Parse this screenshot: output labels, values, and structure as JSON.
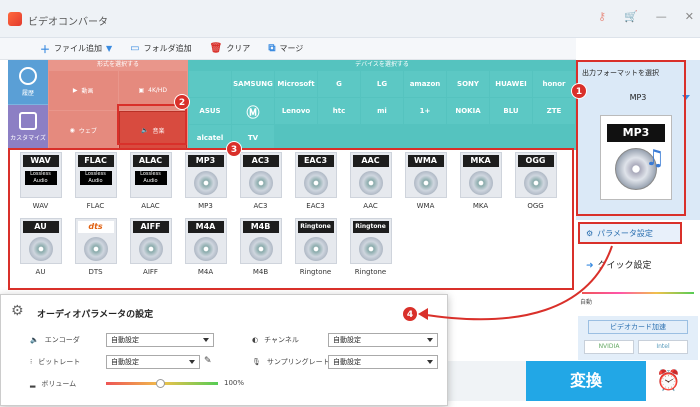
{
  "app": {
    "title": "ビデオコンバータ"
  },
  "toolbar": {
    "add_file": "ファイル追加",
    "add_folder": "フォルダ追加",
    "clear": "クリア",
    "merge": "マージ"
  },
  "sidebar": {
    "history": "履歴",
    "custom": "カスタマイズ"
  },
  "formats": {
    "header": "形式を選択する",
    "items": [
      "動画",
      "4K/HD",
      "ウェブ",
      "音楽"
    ]
  },
  "devices": {
    "header": "デバイスを選択する",
    "row1": [
      "",
      "SAMSUNG",
      "Microsoft",
      "G",
      "LG",
      "amazon",
      "SONY",
      "HUAWEI",
      "honor",
      "ASUS"
    ],
    "row2": [
      "",
      "Lenovo",
      "htc",
      "mi",
      "1+",
      "NOKIA",
      "BLU",
      "ZTE",
      "alcatel",
      "TV"
    ]
  },
  "output": {
    "label": "出力フォーマットを選択",
    "selected": "MP3",
    "big_icon": "MP3"
  },
  "files": [
    {
      "tag": "WAV",
      "name": "WAV",
      "lossless": true
    },
    {
      "tag": "FLAC",
      "name": "FLAC",
      "lossless": true
    },
    {
      "tag": "ALAC",
      "name": "ALAC",
      "lossless": true
    },
    {
      "tag": "MP3",
      "name": "MP3"
    },
    {
      "tag": "AC3",
      "name": "AC3"
    },
    {
      "tag": "EAC3",
      "name": "EAC3"
    },
    {
      "tag": "AAC",
      "name": "AAC"
    },
    {
      "tag": "WMA",
      "name": "WMA"
    },
    {
      "tag": "MKA",
      "name": "MKA"
    },
    {
      "tag": "OGG",
      "name": "OGG"
    },
    {
      "tag": "AU",
      "name": "AU"
    },
    {
      "tag": "dts",
      "name": "DTS"
    },
    {
      "tag": "AIFF",
      "name": "AIFF"
    },
    {
      "tag": "M4A",
      "name": "M4A"
    },
    {
      "tag": "M4B",
      "name": "M4B"
    },
    {
      "tag": "Ringtone",
      "name": "Ringtone"
    },
    {
      "tag": "Ringtone",
      "name": "Ringtone"
    }
  ],
  "lossless_label": "Lossless Audio",
  "param": {
    "link": "パラメータ設定",
    "quick": "クイック設定",
    "auto": "自動"
  },
  "gpu": {
    "title": "ビデオカード加速",
    "nvidia": "NVIDIA",
    "intel": "Intel"
  },
  "convert": "変換",
  "popup": {
    "title": "オーディオパラメータの設定",
    "encoder_label": "エンコーダ",
    "encoder_value": "自動設定",
    "bitrate_label": "ビットレート",
    "bitrate_value": "自動設定",
    "volume_label": "ボリューム",
    "volume_value": "100%",
    "volume_level": 0.48,
    "channel_label": "チャンネル",
    "channel_value": "自動設定",
    "samplerate_label": "サンプリングレート",
    "samplerate_value": "自動設定"
  },
  "badges": [
    "1",
    "2",
    "3",
    "4"
  ],
  "colors": {
    "accent": "#22a7e6",
    "highlight": "#d9302a",
    "format_bg": "#e9968b",
    "device_bg": "#55c3bf"
  }
}
